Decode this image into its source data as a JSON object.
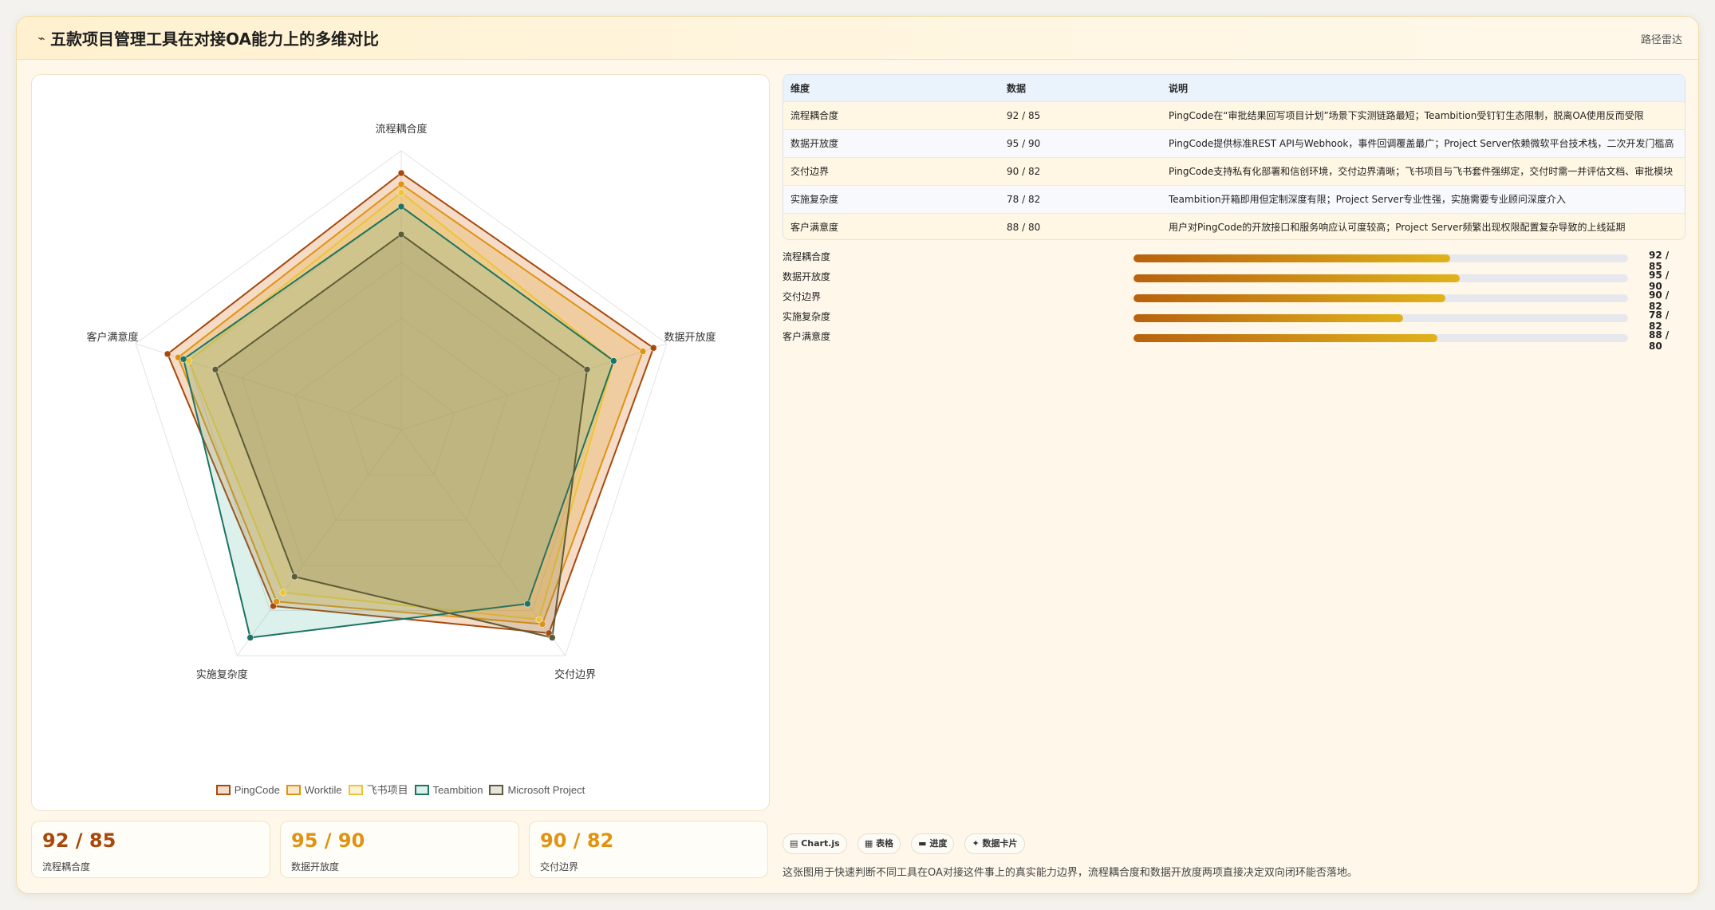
{
  "header": {
    "icon": "chart-line-icon",
    "title": "五款项目管理工具在对接OA能力上的多维对比",
    "path_label": "路径雷达"
  },
  "chart_data": {
    "type": "radar",
    "axes": [
      "流程耦合度",
      "数据开放度",
      "交付边界",
      "实施复杂度",
      "客户满意度"
    ],
    "range": [
      0,
      100
    ],
    "grid_levels": 5,
    "legend_position": "bottom",
    "series": [
      {
        "name": "PingCode",
        "values": [
          92,
          95,
          90,
          78,
          88
        ],
        "color": "#a8490b",
        "fill": "rgba(214,128,56,0.28)"
      },
      {
        "name": "Worktile",
        "values": [
          88,
          91,
          86,
          76,
          84
        ],
        "color": "#e09312",
        "fill": "rgba(226,160,40,0.25)"
      },
      {
        "name": "飞书项目",
        "values": [
          85,
          80,
          84,
          72,
          80
        ],
        "color": "#ecc43a",
        "fill": "rgba(236,196,58,0.22)"
      },
      {
        "name": "Teambition",
        "values": [
          80,
          80,
          77,
          92,
          82
        ],
        "color": "#1c7463",
        "fill": "rgba(60,170,150,0.18)"
      },
      {
        "name": "Microsoft Project",
        "values": [
          70,
          70,
          92,
          65,
          70
        ],
        "color": "#5e5c38",
        "fill": "rgba(120,110,80,0.18)"
      }
    ]
  },
  "kpis": [
    {
      "value": "92 / 85",
      "label": "流程耦合度",
      "color": "#a8490b"
    },
    {
      "value": "95 / 90",
      "label": "数据开放度",
      "color": "#e09312"
    },
    {
      "value": "90 / 82",
      "label": "交付边界",
      "color": "#e09312"
    }
  ],
  "table": {
    "headers": [
      "维度",
      "数据",
      "说明"
    ],
    "rows": [
      {
        "dim": "流程耦合度",
        "data": "92 / 85",
        "desc": "PingCode在“审批结果回写项目计划”场景下实测链路最短；Teambition受钉钉生态限制，脱离OA使用反而受限"
      },
      {
        "dim": "数据开放度",
        "data": "95 / 90",
        "desc": "PingCode提供标准REST API与Webhook，事件回调覆盖最广；Project Server依赖微软平台技术栈，二次开发门槛高"
      },
      {
        "dim": "交付边界",
        "data": "90 / 82",
        "desc": "PingCode支持私有化部署和信创环境，交付边界清晰；飞书项目与飞书套件强绑定，交付时需一并评估文档、审批模块"
      },
      {
        "dim": "实施复杂度",
        "data": "78 / 82",
        "desc": "Teambition开箱即用但定制深度有限；Project Server专业性强，实施需要专业顾问深度介入"
      },
      {
        "dim": "客户满意度",
        "data": "88 / 80",
        "desc": "用户对PingCode的开放接口和服务响应认可度较高；Project Server频繁出现权限配置复杂导致的上线延期"
      }
    ]
  },
  "bars": [
    {
      "label": "流程耦合度",
      "value": "92 / 85",
      "fill_pct": 64
    },
    {
      "label": "数据开放度",
      "value": "95 / 90",
      "fill_pct": 66
    },
    {
      "label": "交付边界",
      "value": "90 / 82",
      "fill_pct": 63
    },
    {
      "label": "实施复杂度",
      "value": "78 / 82",
      "fill_pct": 54.5
    },
    {
      "label": "客户满意度",
      "value": "88 / 80",
      "fill_pct": 61.5
    }
  ],
  "chips": [
    {
      "icon": "chart-icon",
      "label": "▤ Chart.js"
    },
    {
      "icon": "table-icon",
      "label": "▦ 表格"
    },
    {
      "icon": "progress-icon",
      "label": "▬ 进度"
    },
    {
      "icon": "card-icon",
      "label": "✦ 数据卡片"
    }
  ],
  "note": "这张图用于快速判断不同工具在OA对接这件事上的真实能力边界，流程耦合度和数据开放度两项直接决定双向闭环能否落地。"
}
